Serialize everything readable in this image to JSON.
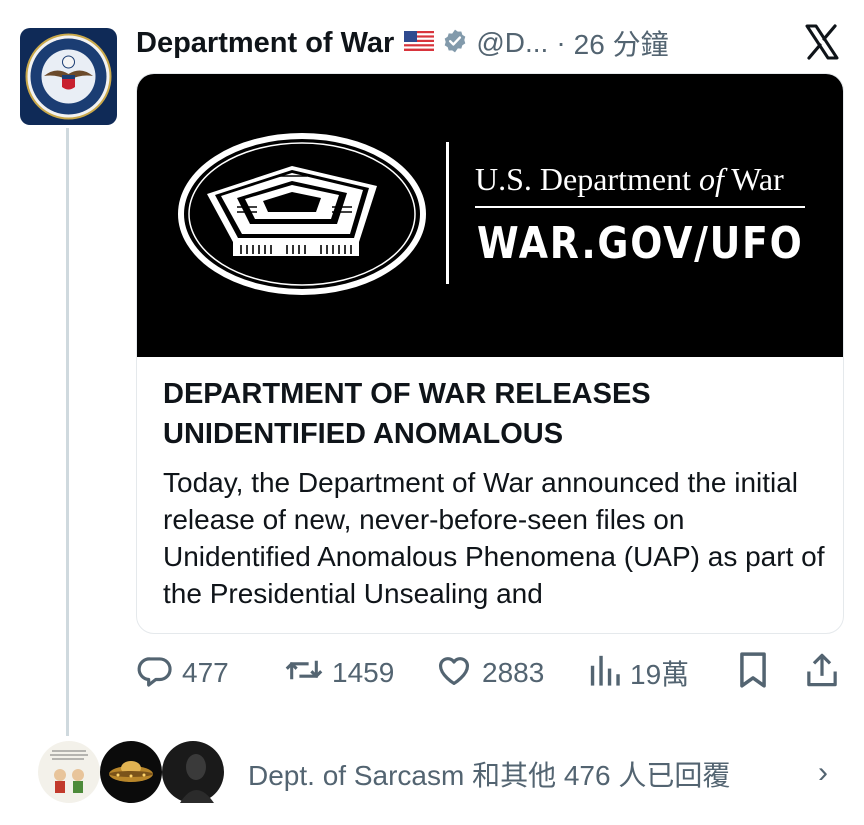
{
  "tweet": {
    "author_name": "Department of War",
    "handle": "@D...",
    "separator": "·",
    "timestamp": "26 分鐘",
    "flag_icon": "us-flag-icon",
    "verified_icon": "verified-badge-icon"
  },
  "card": {
    "image_dept": "U.S. Department",
    "image_dept_of": "of",
    "image_dept_war": "War",
    "image_url": "WAR.GOV/UFO",
    "title": "DEPARTMENT OF WAR RELEASES UNIDENTIFIED ANOMALOUS",
    "description": "Today, the Department of War announced the initial release of new, never-before-seen files on Unidentified Anomalous Phenomena (UAP) as part of the Presidential Unsealing and"
  },
  "actions": {
    "replies": "477",
    "reposts": "1459",
    "likes": "2883",
    "views": "19萬"
  },
  "replies_summary": "Dept. of Sarcasm 和其他 476 人已回覆",
  "colors": {
    "text": "#0f1419",
    "muted": "#536471",
    "verified_gray": "#829aab",
    "navy": "#0f2a57"
  }
}
